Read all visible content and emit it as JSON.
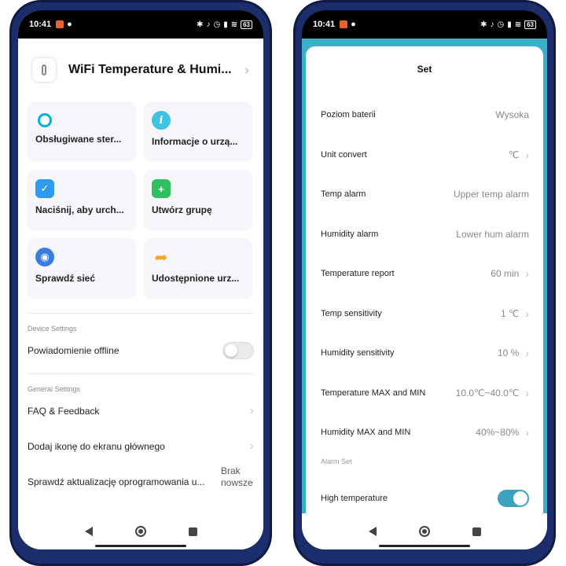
{
  "status_bar": {
    "time": "10:41",
    "battery": "63"
  },
  "left": {
    "device_title": "WiFi Temperature & Humi...",
    "tiles": [
      {
        "label": "Obsługiwane ster...",
        "icon": "alexa-icon",
        "color": "#00b4d8"
      },
      {
        "label": "Informacje o urzą...",
        "icon": "info-icon",
        "color": "#3ec4e0"
      },
      {
        "label": "Naciśnij, aby urch...",
        "icon": "shield-check-icon",
        "color": "#2f9bf0"
      },
      {
        "label": "Utwórz grupę",
        "icon": "add-group-icon",
        "color": "#2fbf5e"
      },
      {
        "label": "Sprawdź sieć",
        "icon": "network-icon",
        "color": "#3a7de0"
      },
      {
        "label": "Udostępnione urz...",
        "icon": "share-icon",
        "color": "#f5a623"
      }
    ],
    "device_settings_label": "Device Settings",
    "offline_notification": "Powiadomienie offline",
    "general_settings_label": "General Settings",
    "faq": "FAQ & Feedback",
    "add_icon": "Dodaj ikonę do ekranu głównego",
    "firmware": "Sprawdź aktualizację oprogramowania u...",
    "firmware_status": "Brak nowsze"
  },
  "right": {
    "title": "Set",
    "rows": [
      {
        "label": "Poziom baterii",
        "value": "Wysoka",
        "chevron": false
      },
      {
        "label": "Unit convert",
        "value": "℃",
        "chevron": true
      },
      {
        "label": "Temp alarm",
        "value": "Upper temp alarm",
        "chevron": false
      },
      {
        "label": "Humidity alarm",
        "value": "Lower hum alarm",
        "chevron": false
      },
      {
        "label": "Temperature report",
        "value": "60 min",
        "chevron": true
      },
      {
        "label": "Temp sensitivity",
        "value": "1 ℃",
        "chevron": true
      },
      {
        "label": "Humidity sensitivity",
        "value": "10 %",
        "chevron": true
      },
      {
        "label": "Temperature MAX and MIN",
        "value": "10.0℃~40.0℃",
        "chevron": true
      },
      {
        "label": "Humidity MAX and MIN",
        "value": "40%~80%",
        "chevron": true
      }
    ],
    "alarm_set_label": "Alarm Set",
    "high_temperature": "High temperature",
    "high_temperature_on": true
  },
  "colors": {
    "accent": "#3bb0c6",
    "toggle_on": "#3ba2bf",
    "frame": "#1b2d6b"
  }
}
